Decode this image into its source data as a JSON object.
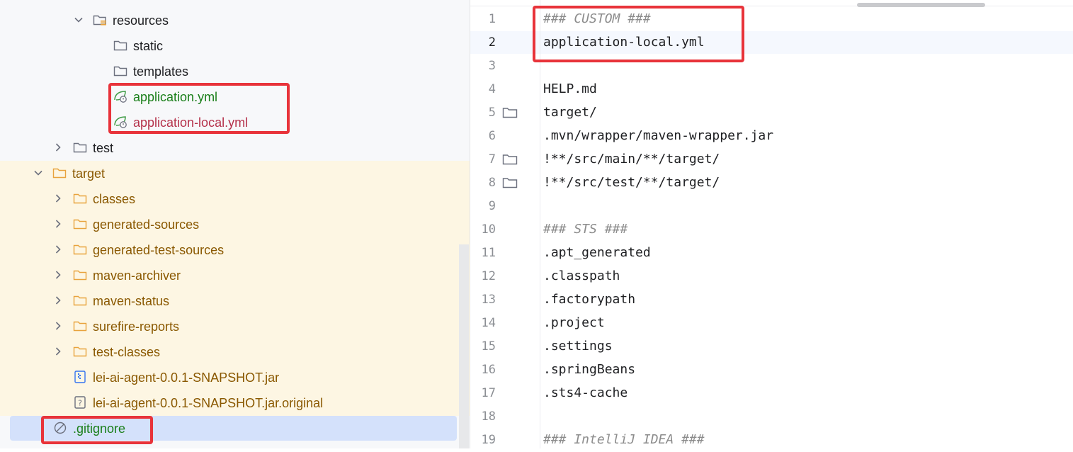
{
  "tree": {
    "items": [
      {
        "label": "resources",
        "expanded": true,
        "icon": "resources-folder-icon"
      },
      {
        "label": "static",
        "icon": "folder-icon"
      },
      {
        "label": "templates",
        "icon": "folder-icon"
      },
      {
        "label": "application.yml",
        "icon": "spring-config-icon",
        "vcs_status": "added"
      },
      {
        "label": "application-local.yml",
        "icon": "spring-config-icon",
        "vcs_status": "ignored"
      },
      {
        "label": "test",
        "expanded": false,
        "icon": "folder-icon"
      },
      {
        "label": "target",
        "expanded": true,
        "icon": "excluded-folder-icon"
      },
      {
        "label": "classes",
        "expanded": false,
        "icon": "excluded-folder-icon"
      },
      {
        "label": "generated-sources",
        "expanded": false,
        "icon": "excluded-folder-icon"
      },
      {
        "label": "generated-test-sources",
        "expanded": false,
        "icon": "excluded-folder-icon"
      },
      {
        "label": "maven-archiver",
        "expanded": false,
        "icon": "excluded-folder-icon"
      },
      {
        "label": "maven-status",
        "expanded": false,
        "icon": "excluded-folder-icon"
      },
      {
        "label": "surefire-reports",
        "expanded": false,
        "icon": "excluded-folder-icon"
      },
      {
        "label": "test-classes",
        "expanded": false,
        "icon": "excluded-folder-icon"
      },
      {
        "label": "lei-ai-agent-0.0.1-SNAPSHOT.jar",
        "icon": "jar-file-icon"
      },
      {
        "label": "lei-ai-agent-0.0.1-SNAPSHOT.jar.original",
        "icon": "unknown-file-icon"
      },
      {
        "label": ".gitignore",
        "icon": "gitignore-icon",
        "selected": true,
        "vcs_status": "added"
      }
    ]
  },
  "editor": {
    "current_line": 2,
    "lines": [
      {
        "n": "1",
        "text": "### CUSTOM ###",
        "type": "comment"
      },
      {
        "n": "2",
        "text": "application-local.yml",
        "type": "entry"
      },
      {
        "n": "3",
        "text": "",
        "type": "blank"
      },
      {
        "n": "4",
        "text": "HELP.md",
        "type": "entry"
      },
      {
        "n": "5",
        "text": "target/",
        "type": "entry",
        "folder_marker": true
      },
      {
        "n": "6",
        "text": ".mvn/wrapper/maven-wrapper.jar",
        "type": "entry"
      },
      {
        "n": "7",
        "text": "!**/src/main/**/target/",
        "type": "entry",
        "folder_marker": true
      },
      {
        "n": "8",
        "text": "!**/src/test/**/target/",
        "type": "entry",
        "folder_marker": true
      },
      {
        "n": "9",
        "text": "",
        "type": "blank"
      },
      {
        "n": "10",
        "text": "### STS ###",
        "type": "comment"
      },
      {
        "n": "11",
        "text": ".apt_generated",
        "type": "entry"
      },
      {
        "n": "12",
        "text": ".classpath",
        "type": "entry"
      },
      {
        "n": "13",
        "text": ".factorypath",
        "type": "entry"
      },
      {
        "n": "14",
        "text": ".project",
        "type": "entry"
      },
      {
        "n": "15",
        "text": ".settings",
        "type": "entry"
      },
      {
        "n": "16",
        "text": ".springBeans",
        "type": "entry"
      },
      {
        "n": "17",
        "text": ".sts4-cache",
        "type": "entry"
      },
      {
        "n": "18",
        "text": "",
        "type": "blank"
      },
      {
        "n": "19",
        "text": "### IntelliJ IDEA ###",
        "type": "comment"
      }
    ]
  },
  "colors": {
    "annotation_box": "#e8333a",
    "vcs_added": "#1a7f1a",
    "vcs_ignored": "#b5314a",
    "excluded_text": "#8a5800",
    "excluded_row_bg": "#fdf6e3",
    "selection_bg": "#d4e1fb",
    "folder_orange": "#e8a33d"
  }
}
